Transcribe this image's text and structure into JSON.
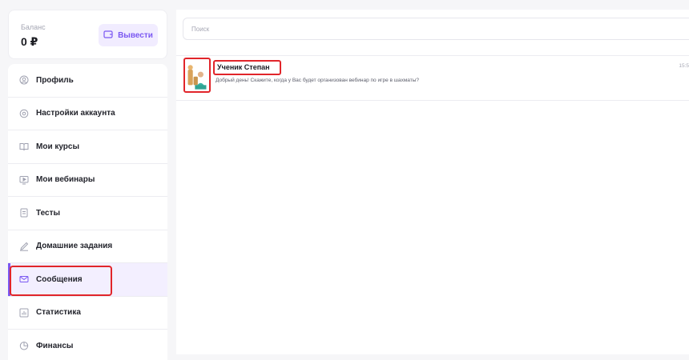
{
  "balance": {
    "label": "Баланс",
    "value": "0 ₽",
    "withdraw_label": "Вывести"
  },
  "menu": {
    "items": [
      {
        "label": "Профиль",
        "icon": "user-circle-icon"
      },
      {
        "label": "Настройки аккаунта",
        "icon": "gear-icon"
      },
      {
        "label": "Мои курсы",
        "icon": "book-icon"
      },
      {
        "label": "Мои вебинары",
        "icon": "video-icon"
      },
      {
        "label": "Тесты",
        "icon": "document-icon"
      },
      {
        "label": "Домашние задания",
        "icon": "pencil-icon"
      },
      {
        "label": "Сообщения",
        "icon": "envelope-icon",
        "active": true
      },
      {
        "label": "Статистика",
        "icon": "chart-icon"
      },
      {
        "label": "Финансы",
        "icon": "pie-chart-icon"
      }
    ]
  },
  "search": {
    "placeholder": "Поиск"
  },
  "chats": [
    {
      "name": "Ученик Степан",
      "message": "Добрый день! Скажите, когда у Вас будет организован вебинар по игре в шахматы?",
      "time": "15:5"
    }
  ],
  "colors": {
    "accent": "#7b58f2",
    "highlight": "#e1252a"
  }
}
